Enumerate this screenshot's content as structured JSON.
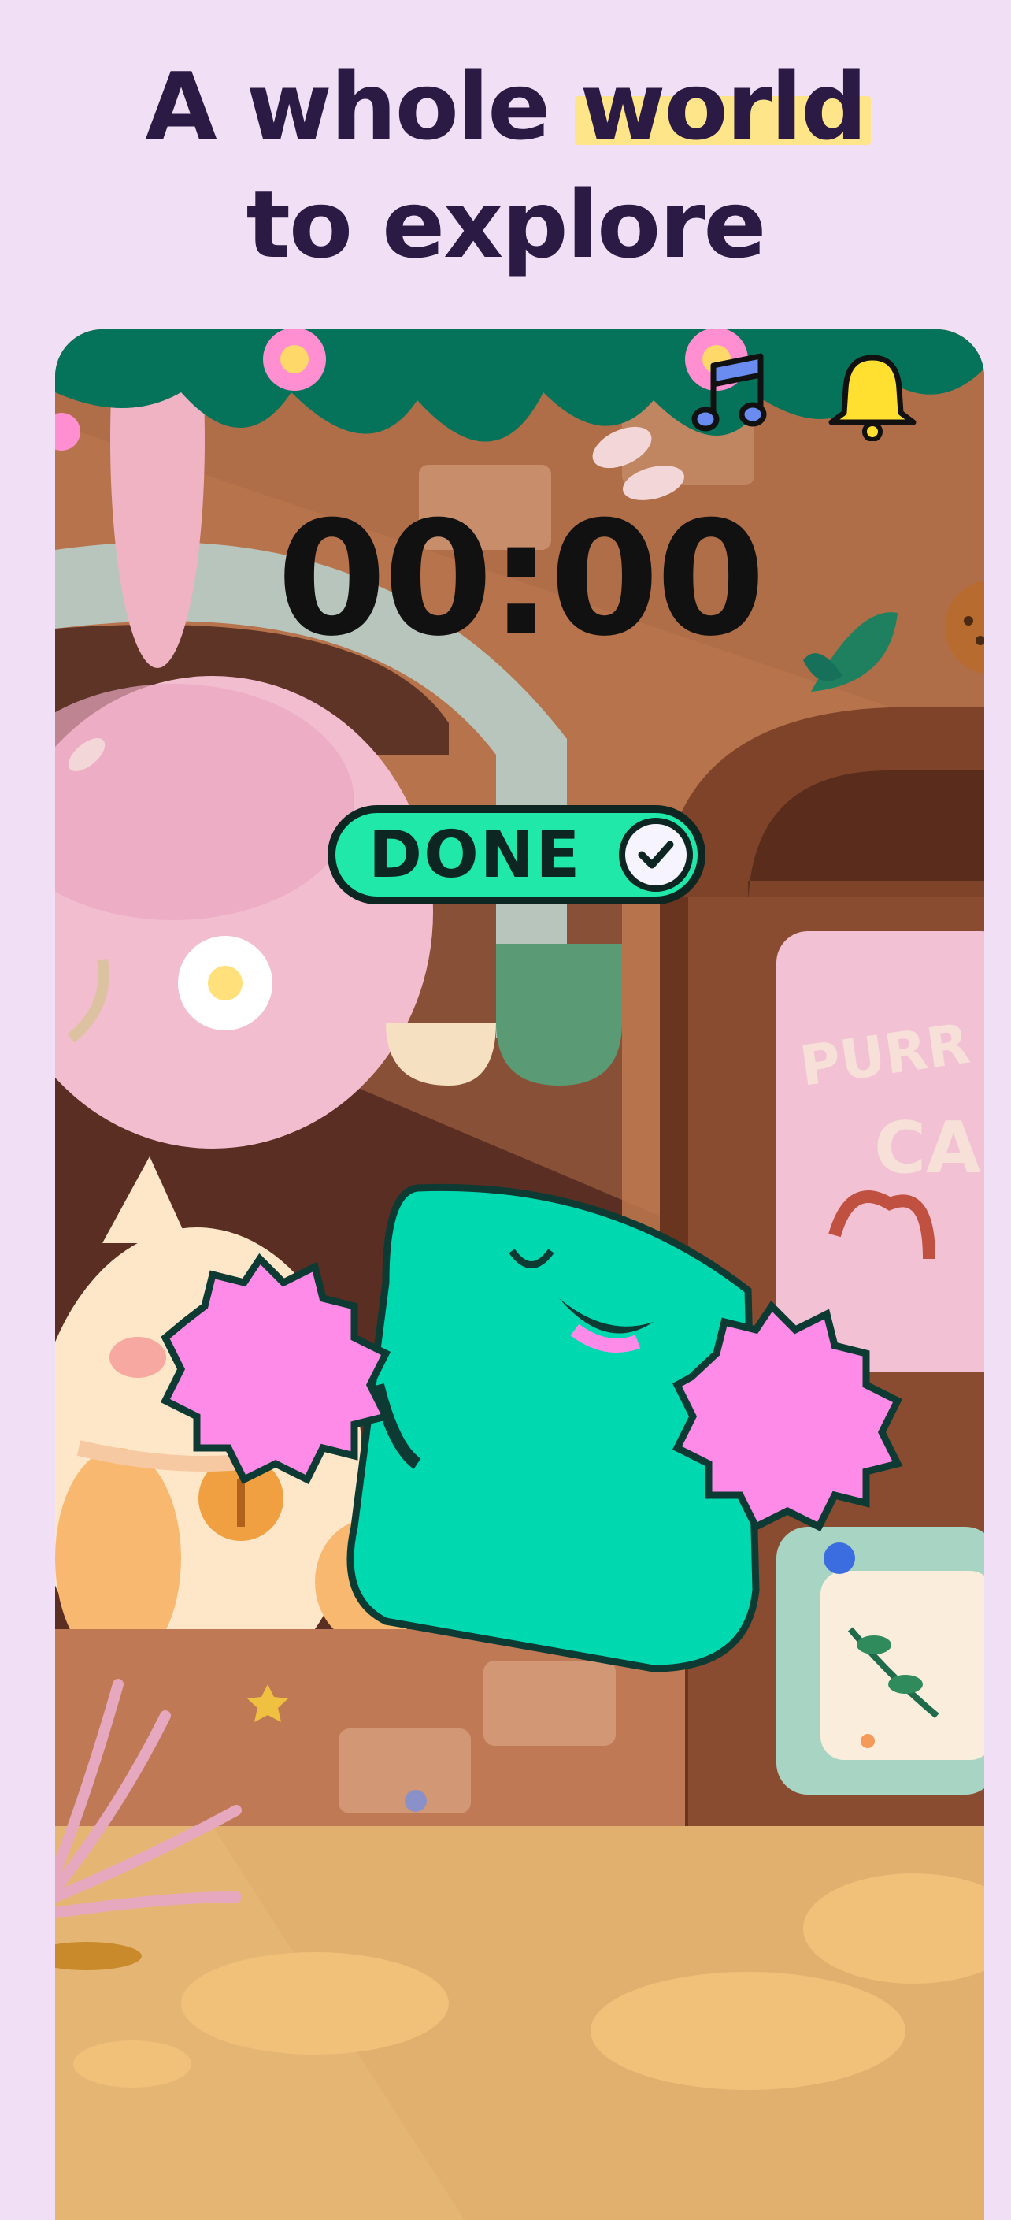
{
  "headline": {
    "line1_pre": "A whole ",
    "line1_highlight": "world",
    "line2": "to explore"
  },
  "timer": {
    "value": "00:00"
  },
  "done_button": {
    "label": "DONE"
  },
  "toolbar": {
    "music_icon": "music-note-icon",
    "bell_icon": "bell-icon"
  },
  "scene": {
    "sign_line1": "PURR",
    "sign_line2": "CA"
  },
  "colors": {
    "background": "#f1e0f5",
    "headline": "#2a1a44",
    "highlight": "#ffe58a",
    "done_green": "#1fe8a8",
    "character": "#00d9b0",
    "pompom": "#ff8be8",
    "bell": "#ffe030",
    "leaf_green": "#05735a"
  }
}
